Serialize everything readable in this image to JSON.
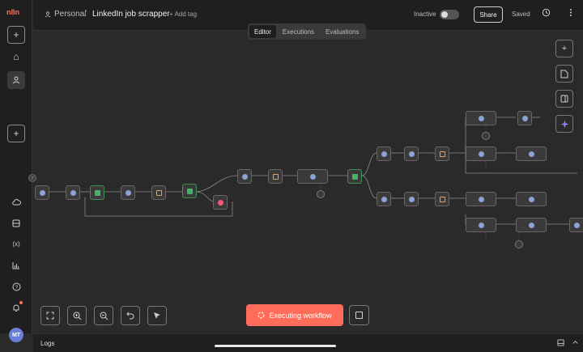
{
  "app": {
    "logo_text": "n8n"
  },
  "sidebar": {
    "items": [
      {
        "name": "add",
        "glyph": "+"
      },
      {
        "name": "home",
        "glyph": "⌂"
      },
      {
        "name": "personal",
        "glyph": "👤"
      },
      {
        "name": "add-project",
        "glyph": "+"
      },
      {
        "name": "cloud",
        "glyph": "☁"
      },
      {
        "name": "templates",
        "glyph": "▣"
      },
      {
        "name": "variables",
        "glyph": "(x)"
      },
      {
        "name": "insights",
        "glyph": "▥"
      },
      {
        "name": "help",
        "glyph": "?"
      },
      {
        "name": "notifications",
        "glyph": "🔔"
      }
    ],
    "avatar_initials": "MT"
  },
  "header": {
    "project": "Personal",
    "separator": "/",
    "workflow_name": "LinkedIn job scrapper",
    "add_tag": "+ Add tag",
    "active_state": "Inactive",
    "share_label": "Share",
    "saved_label": "Saved"
  },
  "tabs": [
    {
      "label": "Editor",
      "active": true
    },
    {
      "label": "Executions",
      "active": false
    },
    {
      "label": "Evaluations",
      "active": false
    }
  ],
  "canvas": {
    "right_tools": [
      "plus-icon",
      "sticky-note-icon",
      "panel-icon",
      "ai-sparkle-icon"
    ],
    "bottom_tools": [
      "fit-view-icon",
      "zoom-in-icon",
      "zoom-out-icon",
      "undo-icon",
      "select-cursor-icon"
    ],
    "execute_label": "Executing workflow"
  },
  "logs": {
    "label": "Logs"
  },
  "colors": {
    "accent": "#ff6d5a",
    "canvas_bg": "#2a2a2a",
    "panel_bg": "#1f1f1f",
    "ai_accent": "#9b7cff"
  }
}
